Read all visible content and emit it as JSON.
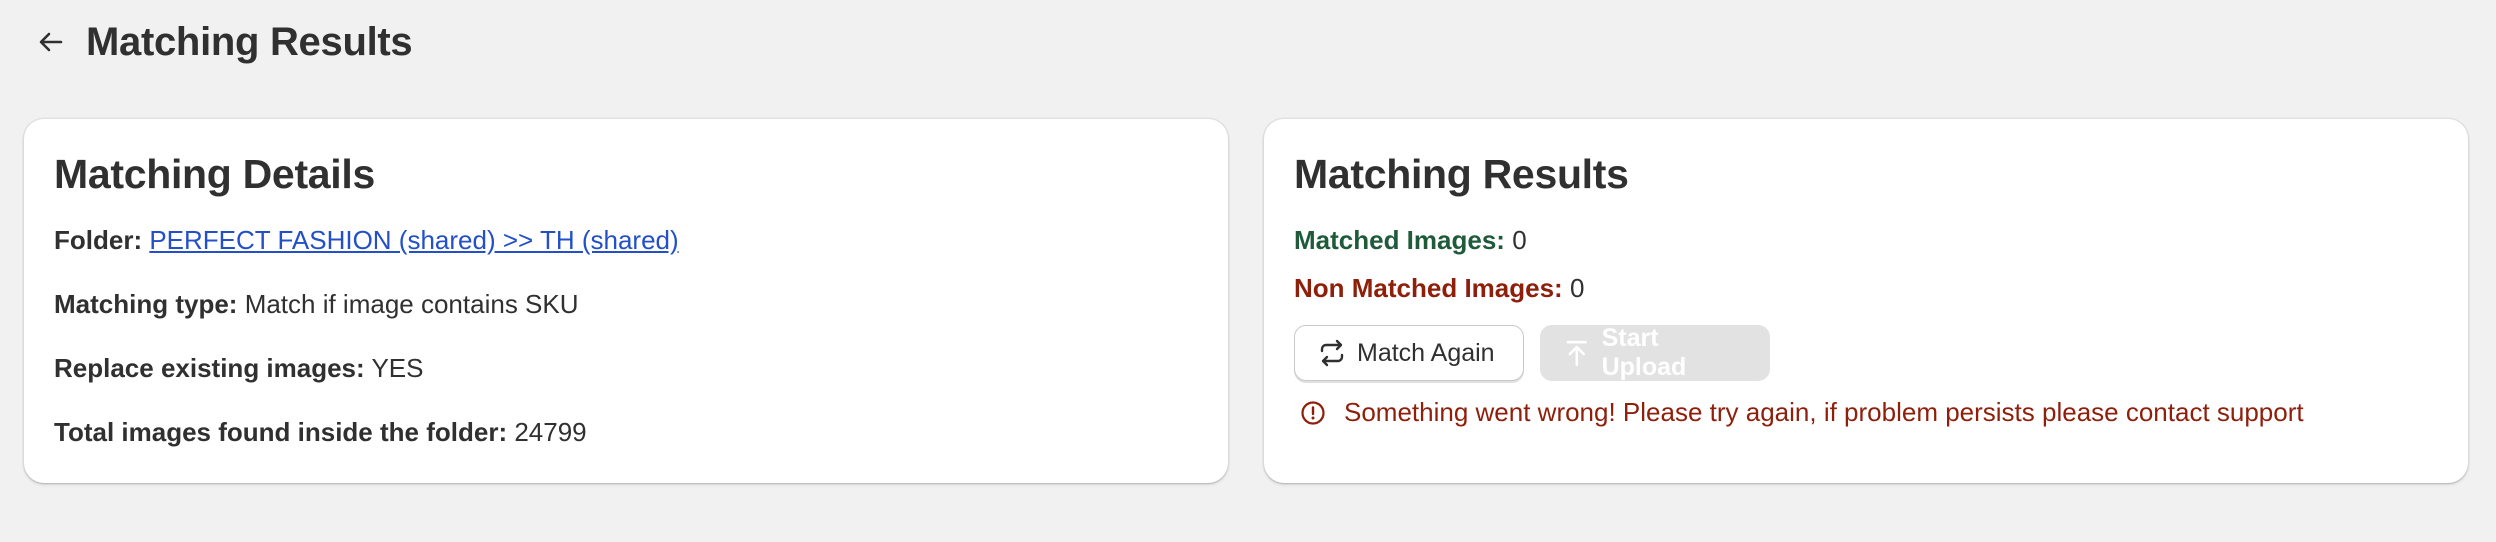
{
  "header": {
    "title": "Matching Results"
  },
  "details": {
    "title": "Matching Details",
    "folder_label": "Folder:",
    "folder_value": "PERFECT FASHION (shared) >> TH (shared)",
    "type_label": "Matching type:",
    "type_value": "Match if image contains SKU",
    "replace_label": "Replace existing images:",
    "replace_value": "YES",
    "total_label": "Total images found inside the folder:",
    "total_value": "24799"
  },
  "results": {
    "title": "Matching Results",
    "matched_label": "Matched Images:",
    "matched_value": "0",
    "non_matched_label": "Non Matched Images:",
    "non_matched_value": "0",
    "match_again_label": "Match Again",
    "start_upload_label": "Start Upload",
    "error_message": "Something went wrong! Please try again, if problem persists please contact support"
  },
  "colors": {
    "background": "#f1f1f1",
    "link": "#2350c8",
    "success": "#1f5b3a",
    "critical": "#8e1f0b",
    "disabled": "#e2e2e2"
  },
  "icons": {
    "back": "arrow-left-icon",
    "match_again": "refresh-icon",
    "start_upload": "upload-icon",
    "error": "alert-circle-icon"
  }
}
